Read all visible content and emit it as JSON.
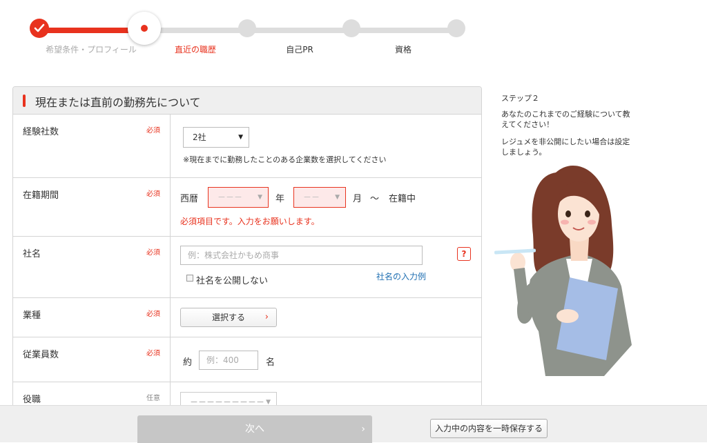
{
  "stepper": {
    "steps": [
      {
        "label": "希望条件・プロフィール",
        "state": "done"
      },
      {
        "label": "直近の職歴",
        "state": "current"
      },
      {
        "label": "自己PR",
        "state": "todo"
      },
      {
        "label": "資格",
        "state": "todo"
      },
      {
        "label": "",
        "state": "todo"
      }
    ]
  },
  "section": {
    "title": "現在または直前の勤務先について"
  },
  "fields": {
    "companies": {
      "label": "経験社数",
      "required": "必須",
      "value": "2社",
      "hint": "※現在までに勤務したことのある企業数を選択してください"
    },
    "tenure": {
      "label": "在籍期間",
      "required": "必須",
      "era": "西暦",
      "year_placeholder": "－－－",
      "year_unit": "年",
      "month_placeholder": "－－",
      "month_unit": "月",
      "tilde": "～",
      "current": "在籍中",
      "error": "必須項目です。入力をお願いします。"
    },
    "company_name": {
      "label": "社名",
      "required": "必須",
      "placeholder": "例：株式会社かもめ商事",
      "help_label": "?",
      "private_label": "社名を公開しない",
      "example_link": "社名の入力例"
    },
    "industry": {
      "label": "業種",
      "required": "必須",
      "button": "選択する",
      "chevron": "›"
    },
    "employees": {
      "label": "従業員数",
      "required": "必須",
      "prefix": "約",
      "placeholder": "例：400",
      "unit": "名"
    },
    "position": {
      "label": "役職",
      "required": "任意",
      "placeholder": "－－－－－－－－－"
    }
  },
  "side": {
    "step": "ステップ２",
    "message1": "あなたのこれまでのご経験について教えてください！",
    "message2": "レジュメを非公開にしたい場合は設定しましょう。"
  },
  "footer": {
    "next_label": "次へ",
    "next_chevron": "›",
    "save_label": "入力中の内容を一時保存する"
  },
  "colors": {
    "accent": "#e8321e",
    "link": "#1f6fb2",
    "disabled": "#c6c6c6"
  }
}
